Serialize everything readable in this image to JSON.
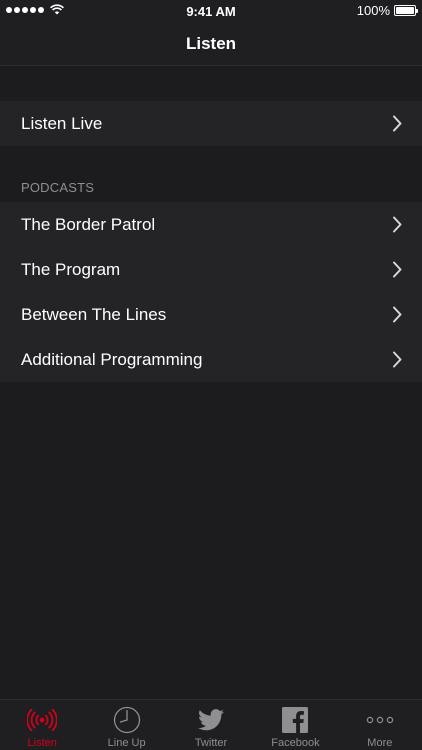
{
  "status_bar": {
    "time": "9:41 AM",
    "battery": "100%",
    "signal_icon": "signal-dots-icon",
    "wifi_icon": "wifi-icon",
    "battery_icon": "battery-icon"
  },
  "nav": {
    "title": "Listen"
  },
  "live": {
    "label": "Listen Live"
  },
  "podcasts": {
    "header": "PODCASTS",
    "items": [
      {
        "label": "The Border Patrol"
      },
      {
        "label": "The Program"
      },
      {
        "label": "Between The Lines"
      },
      {
        "label": "Additional Programming"
      }
    ]
  },
  "tabs": [
    {
      "label": "Listen",
      "icon": "broadcast-icon",
      "active": true
    },
    {
      "label": "Line Up",
      "icon": "clock-icon",
      "active": false
    },
    {
      "label": "Twitter",
      "icon": "twitter-bird-icon",
      "active": false
    },
    {
      "label": "Facebook",
      "icon": "facebook-icon",
      "active": false
    },
    {
      "label": "More",
      "icon": "more-dots-icon",
      "active": false
    }
  ],
  "colors": {
    "background": "#1c1c1e",
    "row": "#242426",
    "accent": "#d0021b",
    "inactive": "#8e8e93"
  }
}
